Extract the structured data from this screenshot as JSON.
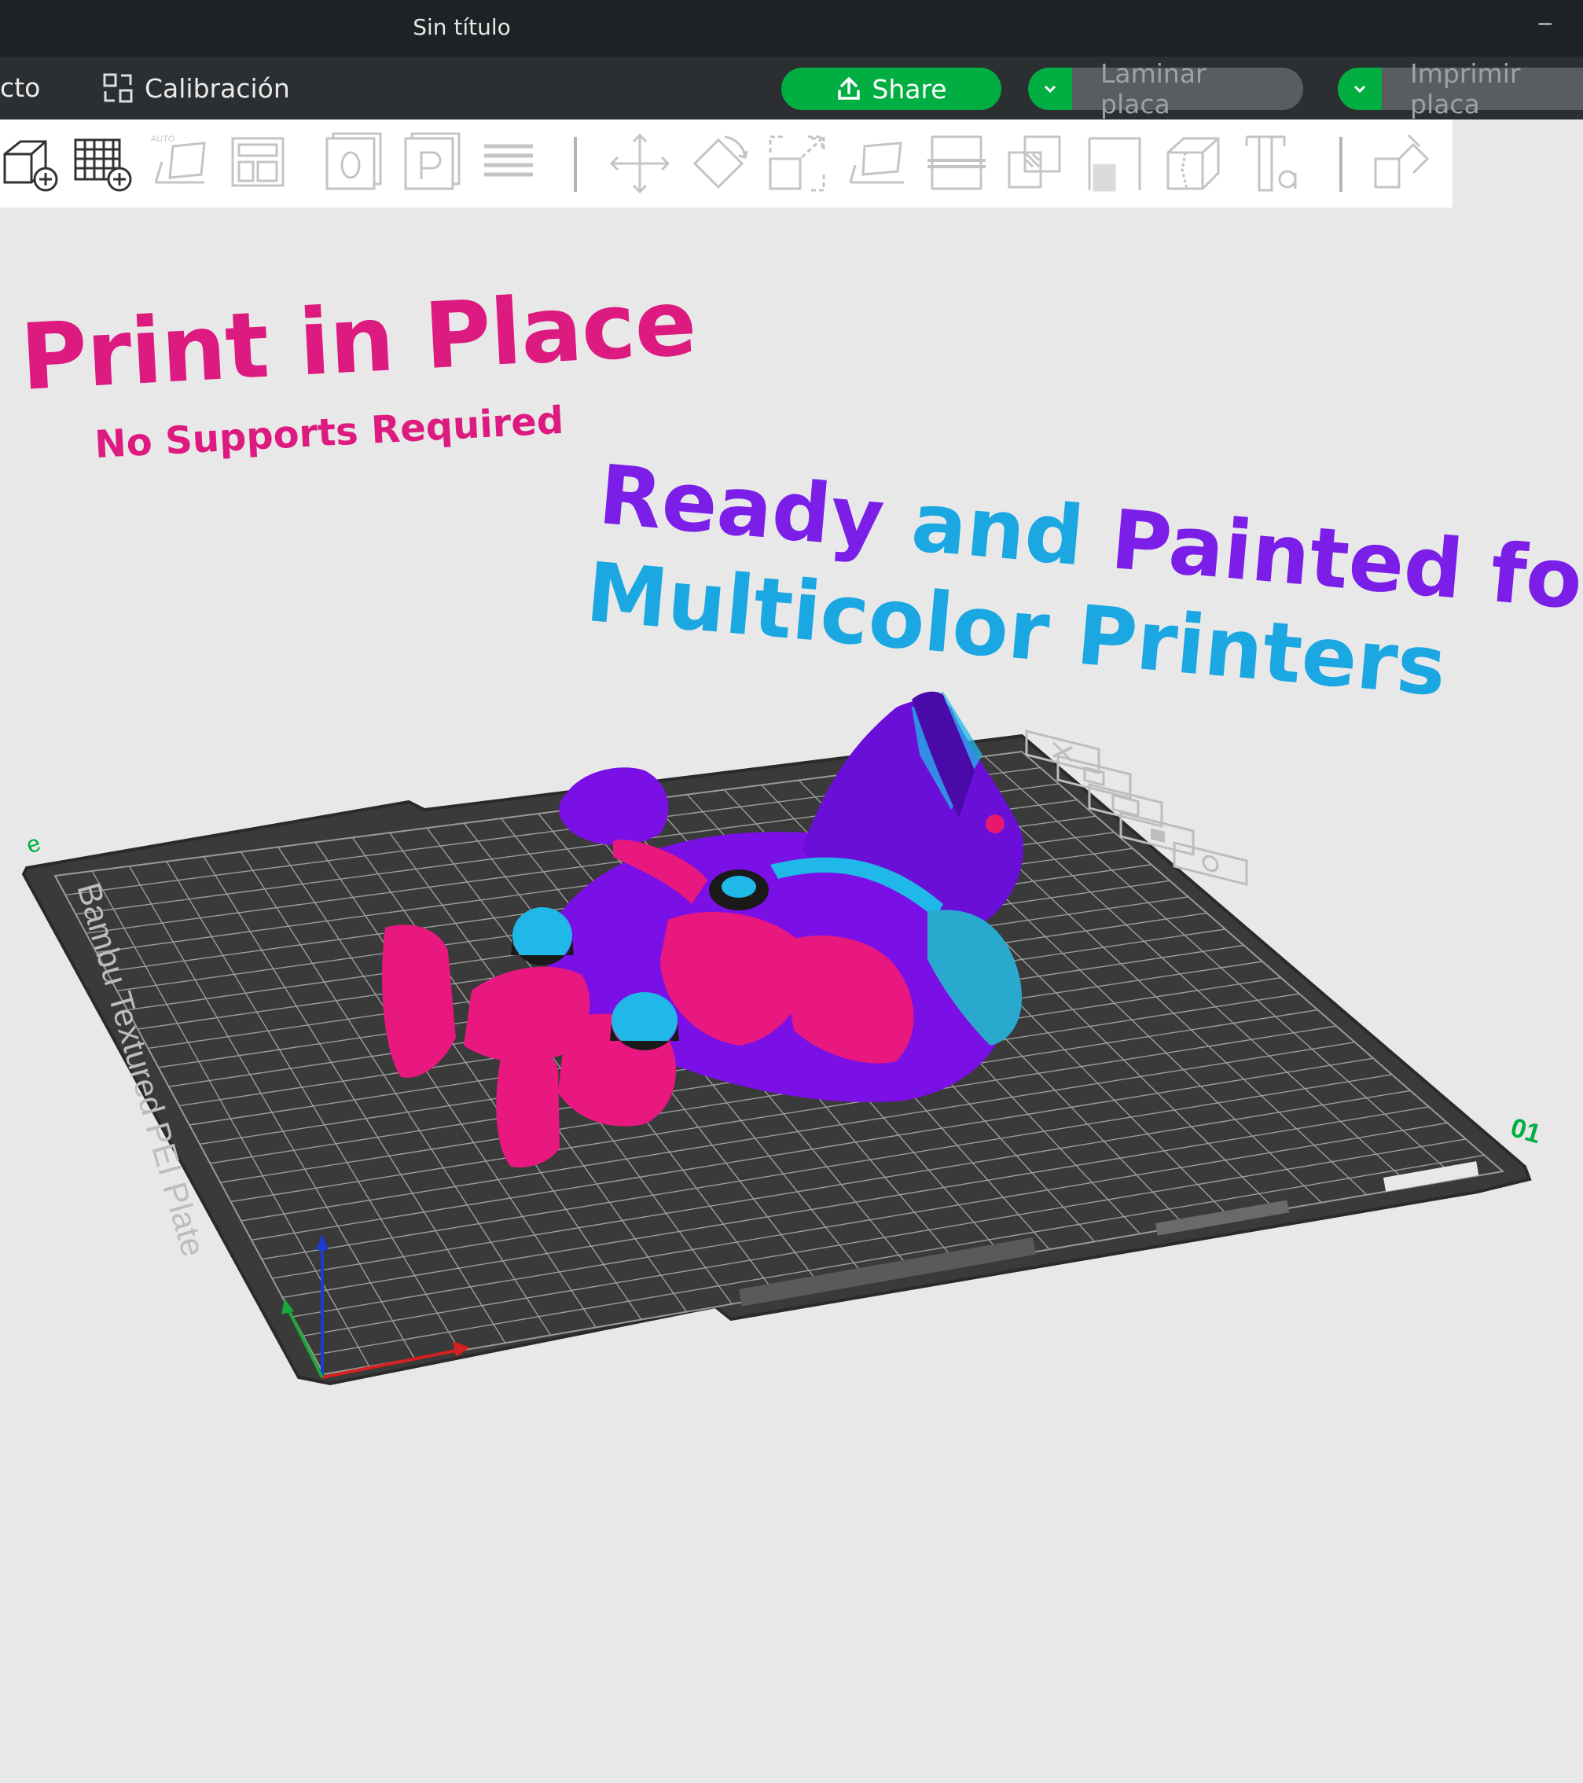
{
  "window": {
    "title": "Sin título",
    "minimize_symbol": "–"
  },
  "menubar": {
    "partial_item": "cto",
    "calibration_label": "Calibración",
    "calibration_icon": "calibration-icon",
    "share_label": "Share",
    "slice_label": "Laminar placa",
    "print_label": "Imprimir placa"
  },
  "colors": {
    "accent_green": "#00ae42",
    "promo_magenta": "#dd1a7f",
    "promo_purple": "#7b1fe8",
    "promo_cyan": "#1aa7e2",
    "plate_gray": "#3a3a3a"
  },
  "toolbar": {
    "icons": [
      "add-object-icon",
      "add-plate-icon",
      "auto-orient-icon",
      "arrange-icon",
      "copy-plate-icon",
      "paste-plate-icon",
      "layers-icon",
      "move-icon",
      "rotate-icon",
      "scale-icon",
      "lay-on-face-icon",
      "cut-icon",
      "boolean-icon",
      "support-paint-icon",
      "seam-paint-icon",
      "text-icon",
      "assembly-icon"
    ]
  },
  "promo": {
    "title": "Print in Place",
    "subtitle": "No Supports Required",
    "line1_word1": "Ready",
    "line1_word2": "and",
    "line1_word3": "Painted for",
    "line2": "Multicolor Printers"
  },
  "plate": {
    "label": "Bambu Textured PEI Plate",
    "number": "01",
    "corner_mark": "e",
    "plate_buttons": [
      "close-icon",
      "copy-icon",
      "arrange-icon",
      "lock-icon",
      "settings-icon"
    ]
  }
}
